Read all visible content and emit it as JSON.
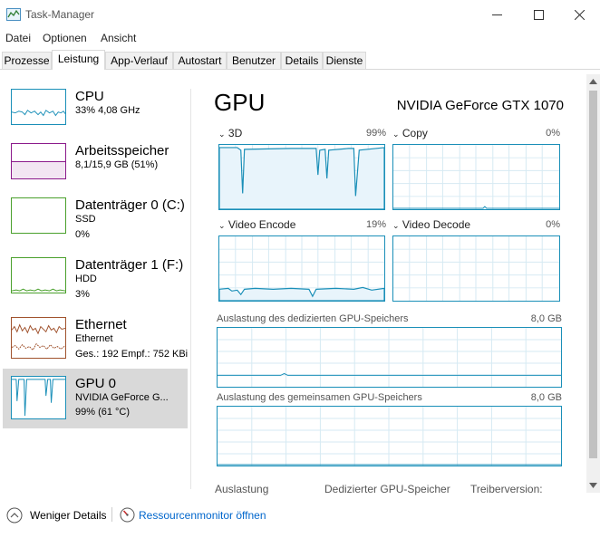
{
  "window": {
    "title": "Task-Manager"
  },
  "menu": [
    "Datei",
    "Optionen",
    "Ansicht"
  ],
  "tabs": [
    "Prozesse",
    "Leistung",
    "App-Verlauf",
    "Autostart",
    "Benutzer",
    "Details",
    "Dienste"
  ],
  "active_tab": "Leistung",
  "sidebar": [
    {
      "name": "CPU",
      "sub1": "33% 4,08 GHz",
      "sub2": "",
      "color": "#1a8fb8"
    },
    {
      "name": "Arbeitsspeicher",
      "sub1": "8,1/15,9 GB (51%)",
      "sub2": "",
      "color": "#8b1a8b"
    },
    {
      "name": "Datenträger 0 (C:)",
      "sub1": "SSD",
      "sub2": "0%",
      "color": "#4aa02c"
    },
    {
      "name": "Datenträger 1 (F:)",
      "sub1": "HDD",
      "sub2": "3%",
      "color": "#4aa02c"
    },
    {
      "name": "Ethernet",
      "sub1": "Ethernet",
      "sub2": "Ges.: 192 Empf.: 752 KBi",
      "color": "#a0522d"
    },
    {
      "name": "GPU 0",
      "sub1": "NVIDIA GeForce G...",
      "sub2": "99% (61 °C)",
      "color": "#1a8fb8"
    }
  ],
  "main": {
    "title": "GPU",
    "model": "NVIDIA GeForce GTX 1070",
    "engines": [
      {
        "label": "3D",
        "pct": "99%"
      },
      {
        "label": "Copy",
        "pct": "0%"
      },
      {
        "label": "Video Encode",
        "pct": "19%"
      },
      {
        "label": "Video Decode",
        "pct": "0%"
      }
    ],
    "dedicated_label": "Auslastung des dedizierten GPU-Speichers",
    "dedicated_max": "8,0 GB",
    "shared_label": "Auslastung des gemeinsamen GPU-Speichers",
    "shared_max": "8,0 GB",
    "stats_headers": [
      "Auslastung",
      "Dedizierter GPU-Speicher",
      "Treiberversion:"
    ]
  },
  "footer": {
    "fewer_details": "Weniger Details",
    "resource_monitor": "Ressourcenmonitor öffnen"
  },
  "colors": {
    "gpu_accent": "#1a8fb8",
    "selected_bg": "#d9d9d9",
    "link": "#0066cc"
  }
}
